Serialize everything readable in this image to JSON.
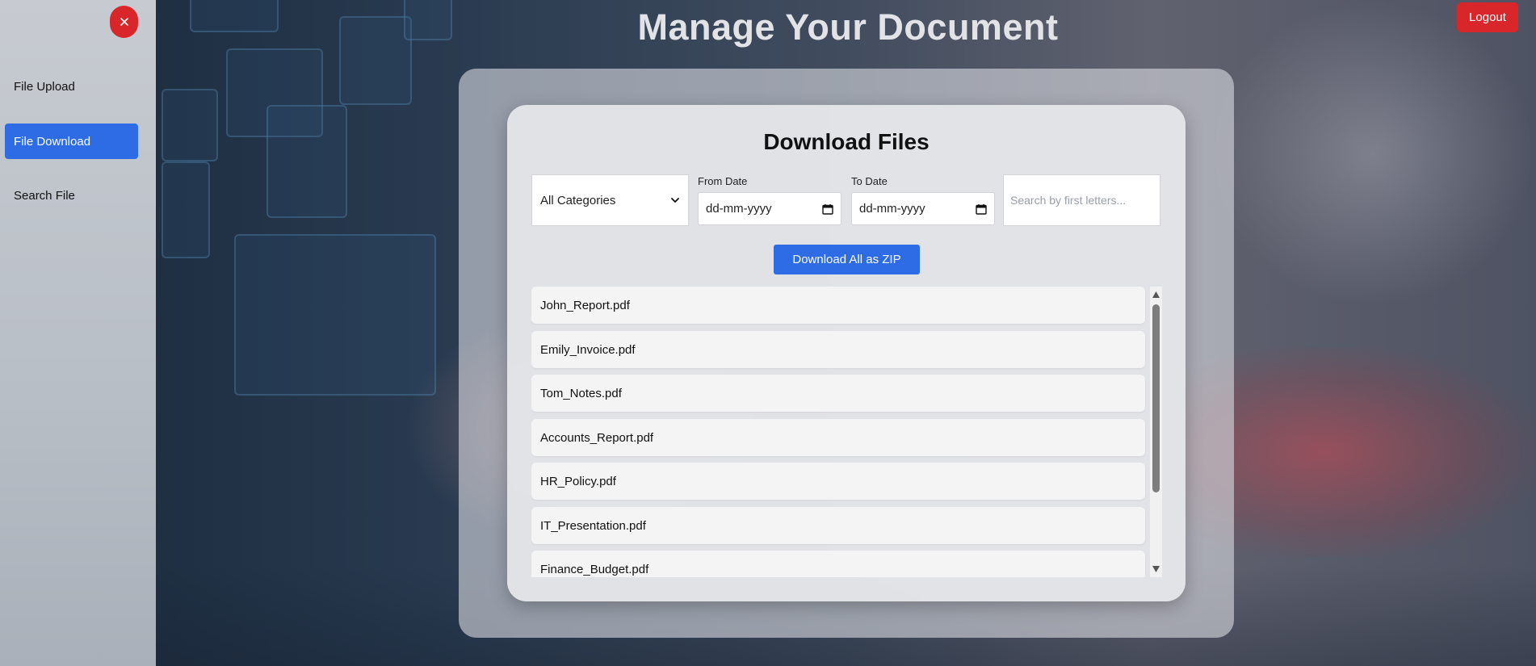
{
  "app": {
    "title": "Manage Your Document"
  },
  "header": {
    "logout_label": "Logout"
  },
  "sidebar": {
    "close_icon": "close-icon",
    "items": [
      {
        "label": "File Upload",
        "active": false
      },
      {
        "label": "File Download",
        "active": true
      },
      {
        "label": "Search File",
        "active": false
      }
    ]
  },
  "download": {
    "title": "Download Files",
    "category_selected": "All Categories",
    "from_date_label": "From Date",
    "from_date_value": "dd-mm-yyyy",
    "to_date_label": "To Date",
    "to_date_value": "dd-mm-yyyy",
    "search_placeholder": "Search by first letters...",
    "zip_button_label": "Download All as ZIP",
    "files": [
      "John_Report.pdf",
      "Emily_Invoice.pdf",
      "Tom_Notes.pdf",
      "Accounts_Report.pdf",
      "HR_Policy.pdf",
      "IT_Presentation.pdf",
      "Finance_Budget.pdf"
    ]
  },
  "colors": {
    "accent_blue": "#2e6ce6",
    "danger_red": "#d9262b"
  }
}
